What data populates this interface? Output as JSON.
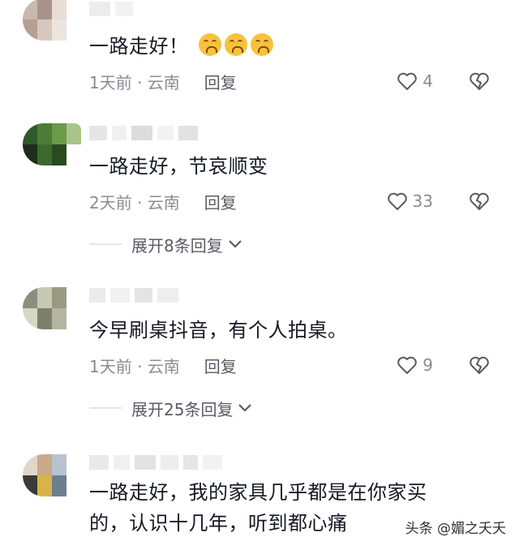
{
  "comments": [
    {
      "text": "一路走好！",
      "emoji_count": 3,
      "time": "1天前 · 云南",
      "reply_label": "回复",
      "likes": "4",
      "expand": null
    },
    {
      "text": "一路走好，节哀顺变",
      "time": "2天前 · 云南",
      "reply_label": "回复",
      "likes": "33",
      "expand": "展开8条回复"
    },
    {
      "text": "今早刷桌抖音，有个人拍桌。",
      "time": "1天前 · 云南",
      "reply_label": "回复",
      "likes": "9",
      "expand": "展开25条回复"
    },
    {
      "text": "一路走好，我的家具几乎都是在你家买的，认识十几年，听到都心痛",
      "text_line1": "一路走好，我的家具几乎都是在你家买",
      "text_line2": "的，认识十几年，听到都心痛",
      "time": null,
      "likes": null,
      "expand": null
    }
  ],
  "watermark": "头条 @媚之夭夭",
  "icons": {
    "like": "heart-outline-icon",
    "dislike": "broken-heart-icon",
    "expand": "chevron-down-icon",
    "emoji": "crying-face-emoji-icon"
  },
  "colors": {
    "text": "#161823",
    "meta": "#8a8b91",
    "divider": "#e5e5e5"
  }
}
